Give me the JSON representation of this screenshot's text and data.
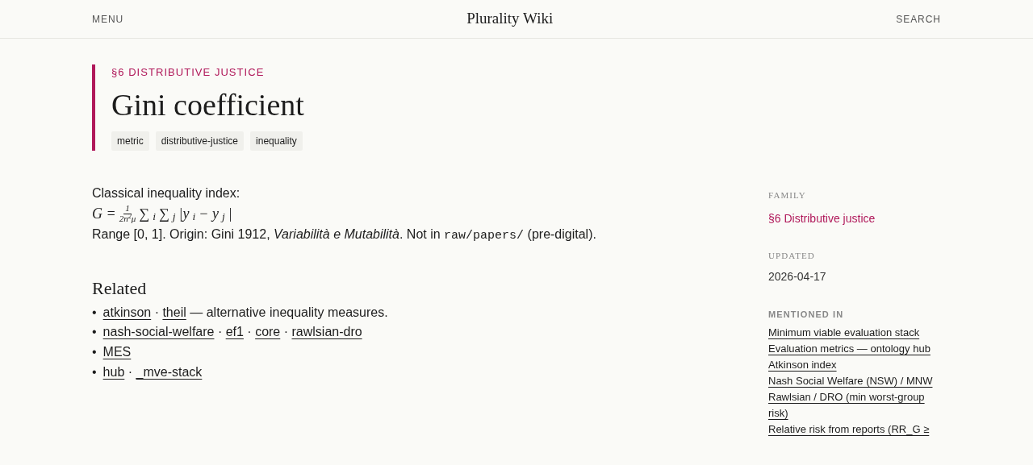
{
  "header": {
    "menu": "MENU",
    "title": "Plurality Wiki",
    "search": "SEARCH"
  },
  "article": {
    "section": "§6 DISTRIBUTIVE JUSTICE",
    "title": "Gini coefficient",
    "tags": [
      "metric",
      "distributive-justice",
      "inequality"
    ],
    "intro": "Classical inequality index:",
    "formula": {
      "lhs": "G",
      "eq": "=",
      "numerator": "1",
      "denominator": "2n$^{2}$μ",
      "body": "∑$_{i}$ ∑$_{j}$ |y$_{i}$ − y$_{j}$|"
    },
    "note": {
      "before": "Range [0, 1]. Origin: Gini 1912, *Variabilità e Mutabilità*. Not in ",
      "code": "raw/papers/",
      "after": " (pre-digital)."
    },
    "related": {
      "heading": "Related",
      "marker": "•",
      "items": [
        {
          "links": [
            "atkinson",
            "theil"
          ],
          "separator": "·",
          "note": "— alternative inequality measures."
        },
        {
          "links": [
            "nash-social-welfare",
            "ef1",
            "core",
            "rawlsian-dro"
          ],
          "separator": "·"
        },
        {
          "links": [
            "MES"
          ]
        },
        {
          "links": [
            "hub",
            "_mve-stack"
          ],
          "separator": "·"
        }
      ]
    }
  },
  "sidebar": {
    "family": {
      "label": "FAMILY",
      "value": "§6 Distributive justice"
    },
    "updated": {
      "label": "UPDATED",
      "value": "2026-04-17"
    },
    "mentioned": {
      "label": "MENTIONED IN",
      "items": [
        "Minimum viable evaluation stack",
        "Evaluation metrics — ontology hub",
        "Atkinson index",
        "Nash Social Welfare (NSW) / MNW",
        "Rawlsian / DRO (min worst-group risk)",
        "Relative risk from reports (RR_G ≥"
      ]
    }
  }
}
